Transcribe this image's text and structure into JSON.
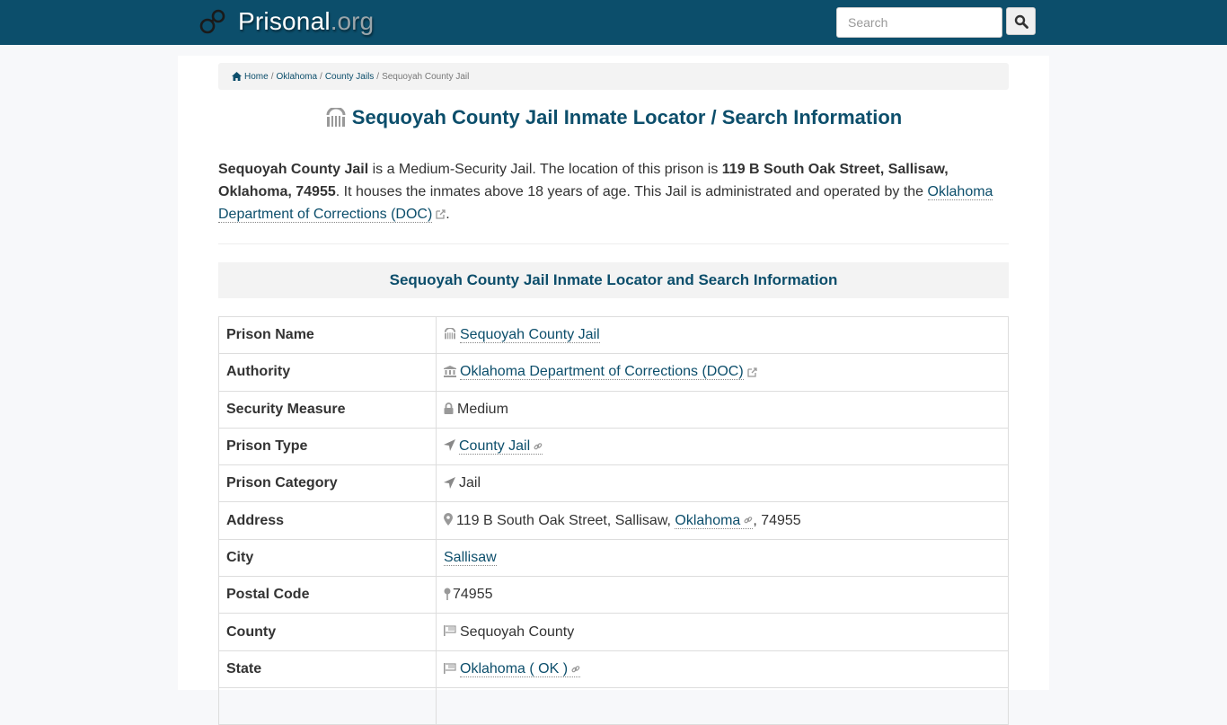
{
  "header": {
    "brand_name": "Prisonal",
    "brand_tld": ".org",
    "search_placeholder": "Search",
    "logo_icon": "handcuffs-icon",
    "search_icon": "search-icon"
  },
  "breadcrumb": {
    "items": [
      {
        "label": "Home",
        "icon": "home-icon",
        "link": true
      },
      {
        "label": "Oklahoma",
        "link": true
      },
      {
        "label": "County Jails",
        "link": true
      },
      {
        "label": "Sequoyah County Jail",
        "link": false
      }
    ]
  },
  "page": {
    "title": "Sequoyah County Jail Inmate Locator / Search Information",
    "intro": {
      "name": "Sequoyah County Jail",
      "t1": " is a Medium-Security Jail. The location of this prison is ",
      "address": "119 B South Oak Street, Sallisaw, Oklahoma, 74955",
      "t2": ". It houses the inmates above 18 years of age. This Jail is administrated and operated by the ",
      "authority_link": "Oklahoma Department of Corrections (DOC)",
      "t3": "."
    },
    "section_heading": "Sequoyah County Jail Inmate Locator and Search Information"
  },
  "table": {
    "rows": [
      {
        "label": "Prison Name",
        "icon": "prison-icon",
        "value": "Sequoyah County Jail",
        "link": true
      },
      {
        "label": "Authority",
        "icon": "institution-icon",
        "value": "Oklahoma Department of Corrections (DOC)",
        "link": true,
        "external": true
      },
      {
        "label": "Security Measure",
        "icon": "lock-icon",
        "value": "Medium",
        "link": false
      },
      {
        "label": "Prison Type",
        "icon": "location-arrow-icon",
        "value": "County Jail",
        "link": true,
        "chain": true
      },
      {
        "label": "Prison Category",
        "icon": "location-arrow-icon",
        "value": "Jail",
        "link": false
      },
      {
        "label": "Address",
        "icon": "map-marker-icon",
        "value_prefix": "119 B South Oak Street, Sallisaw, ",
        "value_link": "Oklahoma",
        "value_suffix": ", 74955"
      },
      {
        "label": "City",
        "value": "Sallisaw",
        "link": true
      },
      {
        "label": "Postal Code",
        "icon": "map-pin-icon",
        "value": "74955",
        "link": false
      },
      {
        "label": "County",
        "icon": "flag-icon",
        "value": "Sequoyah County",
        "link": false
      },
      {
        "label": "State",
        "icon": "flag-icon",
        "value": "Oklahoma ( OK )",
        "link": true,
        "chain": true
      }
    ]
  },
  "colors": {
    "brand": "#0c4e6b",
    "link": "#0c4e6b",
    "text": "#333333"
  }
}
